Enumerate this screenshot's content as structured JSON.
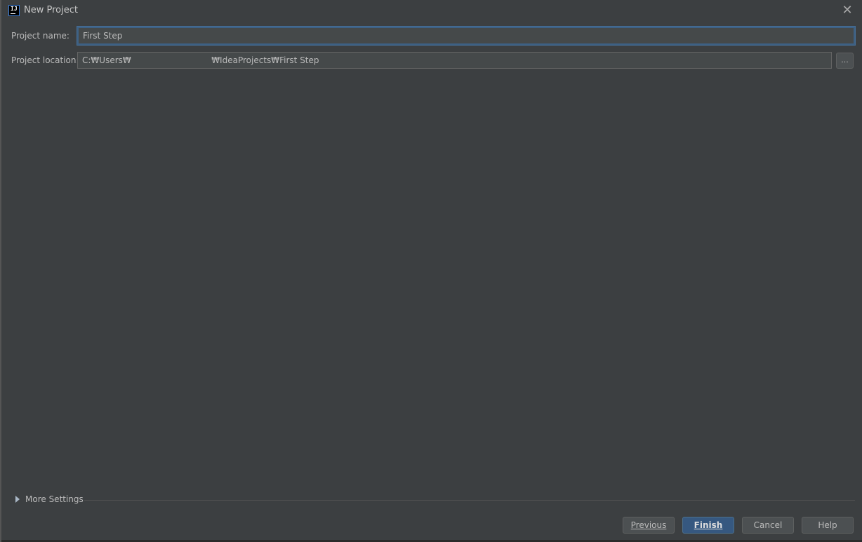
{
  "window": {
    "title": "New Project",
    "app_icon_text": "IJ",
    "close_glyph": "✕"
  },
  "form": {
    "project_name_label": "Project name:",
    "project_name_value": "First Step",
    "project_location_label": "Project location:",
    "project_location_value": "C:₩Users₩                              ₩IdeaProjects₩First Step",
    "browse_label": "..."
  },
  "more_settings": {
    "label": "More Settings",
    "expanded": false
  },
  "buttons": {
    "previous": "Previous",
    "finish": "Finish",
    "cancel": "Cancel",
    "help": "Help"
  },
  "colors": {
    "background": "#3c3f41",
    "field_background": "#45494a",
    "focus_border": "#3d6185",
    "primary_button": "#365880"
  },
  "icons": {
    "app": "intellij-idea-icon",
    "close": "close-icon",
    "expand": "triangle-right-icon"
  }
}
